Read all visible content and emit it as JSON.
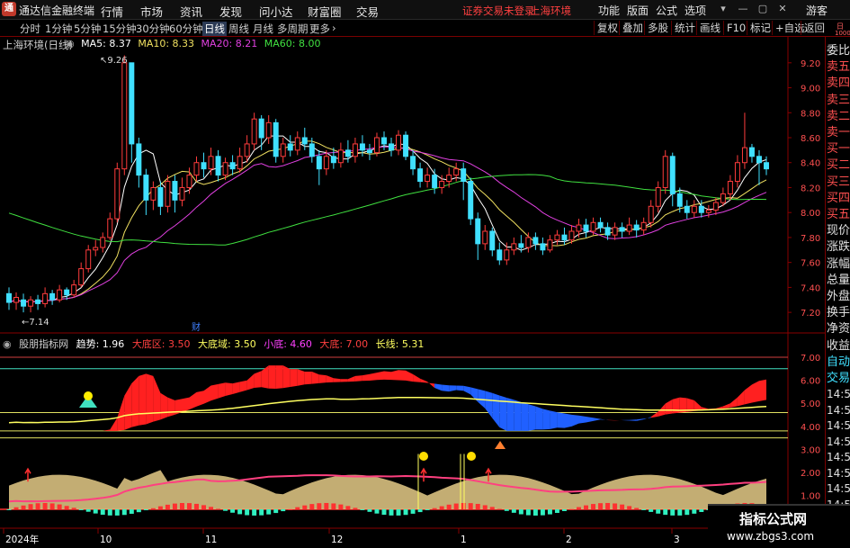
{
  "window": {
    "app_title": "通达信金融终端",
    "logo_text": "通",
    "menu": [
      "行情",
      "市场",
      "资讯",
      "发现",
      "问小达",
      "财富圈",
      "交易"
    ],
    "login_status": "证券交易未登录",
    "market_name": "上海环境",
    "top_menu": [
      "功能",
      "版面",
      "公式",
      "选项"
    ],
    "guest": "游客"
  },
  "toolbar": {
    "periods": [
      "分时",
      "1分钟",
      "5分钟",
      "15分钟",
      "30分钟",
      "60分钟",
      "日线",
      "周线",
      "月线",
      "多周期",
      "更多"
    ],
    "active_period": "日线",
    "right_buttons": [
      "复权",
      "叠加",
      "多股",
      "统计",
      "画线",
      "F10",
      "标记",
      "+自选",
      "返回"
    ]
  },
  "main_chart": {
    "stock_label": "上海环境(日线)",
    "ma": [
      {
        "label": "MA5: 8.37",
        "color": "#ffffff"
      },
      {
        "label": "MA10: 8.33",
        "color": "#f0e060"
      },
      {
        "label": "MA20: 8.21",
        "color": "#e040e0"
      },
      {
        "label": "MA60: 8.00",
        "color": "#40e040"
      }
    ],
    "high_label": "9.26",
    "low_label": "7.14",
    "event_label": "财",
    "y_ticks": [
      "9.20",
      "9.00",
      "8.80",
      "8.60",
      "8.40",
      "8.20",
      "8.00",
      "7.80",
      "7.60",
      "7.40",
      "7.20"
    ]
  },
  "indicator": {
    "name": "股朋指标网",
    "legend": [
      {
        "label": "趋势: 1.96",
        "color": "#ffffff"
      },
      {
        "label": "大底区: 3.50",
        "color": "#ff4040"
      },
      {
        "label": "大底域: 3.50",
        "color": "#ffff60"
      },
      {
        "label": "小底: 4.60",
        "color": "#ff40ff"
      },
      {
        "label": "大底: 7.00",
        "color": "#ff4040"
      },
      {
        "label": "长线: 5.31",
        "color": "#ffff60"
      }
    ],
    "y_ticks": [
      "7.00",
      "6.00",
      "5.00",
      "4.00",
      "3.00",
      "2.00",
      "1.00"
    ]
  },
  "x_axis": {
    "labels": [
      "2024年",
      "10",
      "11",
      "12",
      "1",
      "2",
      "3"
    ]
  },
  "right_panel": {
    "items": [
      {
        "label": "委比",
        "color": "white"
      },
      {
        "label": "卖五",
        "color": "red"
      },
      {
        "label": "卖四",
        "color": "red"
      },
      {
        "label": "卖三",
        "color": "red"
      },
      {
        "label": "卖二",
        "color": "red"
      },
      {
        "label": "卖一",
        "color": "red"
      },
      {
        "label": "买一",
        "color": "red"
      },
      {
        "label": "买二",
        "color": "red"
      },
      {
        "label": "买三",
        "color": "red"
      },
      {
        "label": "买四",
        "color": "red"
      },
      {
        "label": "买五",
        "color": "red"
      },
      {
        "label": "现价",
        "color": "white"
      },
      {
        "label": "涨跌",
        "color": "white"
      },
      {
        "label": "涨幅",
        "color": "white"
      },
      {
        "label": "总量",
        "color": "white"
      },
      {
        "label": "外盘",
        "color": "white"
      },
      {
        "label": "换手",
        "color": "white"
      },
      {
        "label": "净资",
        "color": "white"
      },
      {
        "label": "收益",
        "color": "white"
      },
      {
        "label": "自动",
        "color": "cyan"
      },
      {
        "label": "交易",
        "color": "cyan"
      }
    ],
    "times": [
      "14:56",
      "14:56",
      "14:56",
      "14:56",
      "14:56",
      "14:56",
      "14:56",
      "14:56"
    ],
    "extra_top": [
      "日",
      "1000"
    ]
  },
  "watermark": {
    "title": "指标公式网",
    "url": "www.zbgs3.com"
  },
  "chart_data": {
    "type": "candlestick",
    "ylim": [
      7.1,
      9.35
    ],
    "candles": [
      [
        7.35,
        7.28,
        7.4,
        7.22
      ],
      [
        7.28,
        7.32,
        7.36,
        7.22
      ],
      [
        7.3,
        7.25,
        7.35,
        7.2
      ],
      [
        7.25,
        7.3,
        7.33,
        7.2
      ],
      [
        7.3,
        7.27,
        7.34,
        7.22
      ],
      [
        7.27,
        7.35,
        7.4,
        7.24
      ],
      [
        7.35,
        7.3,
        7.38,
        7.26
      ],
      [
        7.3,
        7.38,
        7.42,
        7.28
      ],
      [
        7.38,
        7.34,
        7.4,
        7.3
      ],
      [
        7.34,
        7.42,
        7.46,
        7.32
      ],
      [
        7.42,
        7.55,
        7.6,
        7.4
      ],
      [
        7.55,
        7.7,
        7.74,
        7.52
      ],
      [
        7.7,
        7.72,
        7.78,
        7.65
      ],
      [
        7.72,
        7.8,
        7.84,
        7.68
      ],
      [
        7.8,
        7.95,
        8.0,
        7.78
      ],
      [
        7.95,
        8.35,
        8.4,
        7.92
      ],
      [
        8.35,
        9.2,
        9.26,
        8.3
      ],
      [
        9.2,
        8.55,
        9.0,
        8.4
      ],
      [
        8.55,
        8.3,
        8.6,
        8.2
      ],
      [
        8.3,
        8.1,
        8.35,
        7.98
      ],
      [
        8.1,
        8.2,
        8.25,
        8.02
      ],
      [
        8.2,
        8.05,
        8.25,
        7.98
      ],
      [
        8.05,
        8.25,
        8.3,
        8.0
      ],
      [
        8.25,
        8.1,
        8.3,
        8.0
      ],
      [
        8.1,
        8.2,
        8.28,
        8.05
      ],
      [
        8.2,
        8.3,
        8.36,
        8.15
      ],
      [
        8.3,
        8.4,
        8.45,
        8.25
      ],
      [
        8.4,
        8.35,
        8.48,
        8.28
      ],
      [
        8.35,
        8.45,
        8.52,
        8.3
      ],
      [
        8.45,
        8.3,
        8.5,
        8.25
      ],
      [
        8.3,
        8.4,
        8.44,
        8.26
      ],
      [
        8.4,
        8.35,
        8.46,
        8.3
      ],
      [
        8.35,
        8.45,
        8.52,
        8.32
      ],
      [
        8.45,
        8.55,
        8.62,
        8.4
      ],
      [
        8.55,
        8.75,
        8.8,
        8.5
      ],
      [
        8.75,
        8.6,
        8.78,
        8.5
      ],
      [
        8.6,
        8.72,
        8.78,
        8.55
      ],
      [
        8.72,
        8.45,
        8.75,
        8.4
      ],
      [
        8.45,
        8.55,
        8.6,
        8.4
      ],
      [
        8.55,
        8.5,
        8.62,
        8.45
      ],
      [
        8.5,
        8.6,
        8.65,
        8.46
      ],
      [
        8.6,
        8.55,
        8.68,
        8.5
      ],
      [
        8.55,
        8.45,
        8.6,
        8.4
      ],
      [
        8.45,
        8.35,
        8.5,
        8.22
      ],
      [
        8.35,
        8.45,
        8.5,
        8.3
      ],
      [
        8.45,
        8.4,
        8.52,
        8.35
      ],
      [
        8.4,
        8.5,
        8.56,
        8.36
      ],
      [
        8.5,
        8.45,
        8.58,
        8.4
      ],
      [
        8.45,
        8.55,
        8.6,
        8.4
      ],
      [
        8.55,
        8.5,
        8.62,
        8.45
      ],
      [
        8.5,
        8.48,
        8.55,
        8.42
      ],
      [
        8.48,
        8.6,
        8.64,
        8.45
      ],
      [
        8.6,
        8.55,
        8.65,
        8.5
      ],
      [
        8.55,
        8.5,
        8.6,
        8.45
      ],
      [
        8.5,
        8.62,
        8.66,
        8.46
      ],
      [
        8.62,
        8.45,
        8.65,
        8.42
      ],
      [
        8.45,
        8.35,
        8.5,
        8.3
      ],
      [
        8.35,
        8.25,
        8.4,
        8.2
      ],
      [
        8.25,
        8.3,
        8.36,
        8.2
      ],
      [
        8.3,
        8.2,
        8.35,
        8.15
      ],
      [
        8.2,
        8.25,
        8.3,
        8.15
      ],
      [
        8.25,
        8.3,
        8.36,
        8.2
      ],
      [
        8.3,
        8.35,
        8.4,
        8.25
      ],
      [
        8.35,
        8.25,
        8.4,
        8.1
      ],
      [
        8.25,
        7.95,
        8.28,
        7.9
      ],
      [
        7.95,
        7.75,
        8.0,
        7.62
      ],
      [
        7.75,
        7.85,
        7.9,
        7.7
      ],
      [
        7.85,
        7.7,
        7.88,
        7.65
      ],
      [
        7.7,
        7.62,
        7.76,
        7.58
      ],
      [
        7.62,
        7.7,
        7.76,
        7.58
      ],
      [
        7.7,
        7.75,
        7.8,
        7.66
      ],
      [
        7.75,
        7.72,
        7.82,
        7.68
      ],
      [
        7.72,
        7.8,
        7.84,
        7.68
      ],
      [
        7.8,
        7.75,
        7.84,
        7.7
      ],
      [
        7.75,
        7.7,
        7.8,
        7.66
      ],
      [
        7.7,
        7.78,
        7.82,
        7.68
      ],
      [
        7.78,
        7.82,
        7.86,
        7.74
      ],
      [
        7.82,
        7.78,
        7.88,
        7.74
      ],
      [
        7.78,
        7.85,
        7.9,
        7.75
      ],
      [
        7.85,
        7.9,
        7.95,
        7.8
      ],
      [
        7.9,
        7.85,
        7.95,
        7.8
      ],
      [
        7.85,
        7.92,
        7.96,
        7.82
      ],
      [
        7.92,
        7.88,
        7.96,
        7.84
      ],
      [
        7.88,
        7.82,
        7.92,
        7.78
      ],
      [
        7.82,
        7.88,
        7.92,
        7.78
      ],
      [
        7.88,
        7.85,
        7.92,
        7.8
      ],
      [
        7.85,
        7.9,
        7.96,
        7.82
      ],
      [
        7.9,
        7.86,
        7.94,
        7.8
      ],
      [
        7.86,
        7.92,
        7.96,
        7.82
      ],
      [
        7.92,
        8.05,
        8.1,
        7.88
      ],
      [
        8.05,
        8.2,
        8.25,
        8.0
      ],
      [
        8.2,
        8.45,
        8.5,
        8.15
      ],
      [
        8.45,
        8.15,
        8.48,
        8.05
      ],
      [
        8.15,
        8.05,
        8.2,
        8.0
      ],
      [
        8.05,
        8.0,
        8.1,
        7.95
      ],
      [
        8.0,
        8.05,
        8.1,
        7.96
      ],
      [
        8.05,
        8.0,
        8.1,
        7.96
      ],
      [
        8.0,
        8.02,
        8.06,
        7.96
      ],
      [
        8.02,
        8.08,
        8.12,
        7.98
      ],
      [
        8.08,
        8.15,
        8.2,
        8.05
      ],
      [
        8.15,
        8.25,
        8.3,
        8.1
      ],
      [
        8.25,
        8.4,
        8.46,
        8.2
      ],
      [
        8.4,
        8.52,
        8.8,
        8.35
      ],
      [
        8.52,
        8.45,
        8.55,
        8.4
      ],
      [
        8.45,
        8.4,
        8.5,
        8.22
      ],
      [
        8.4,
        8.35,
        8.45,
        8.3
      ]
    ]
  }
}
